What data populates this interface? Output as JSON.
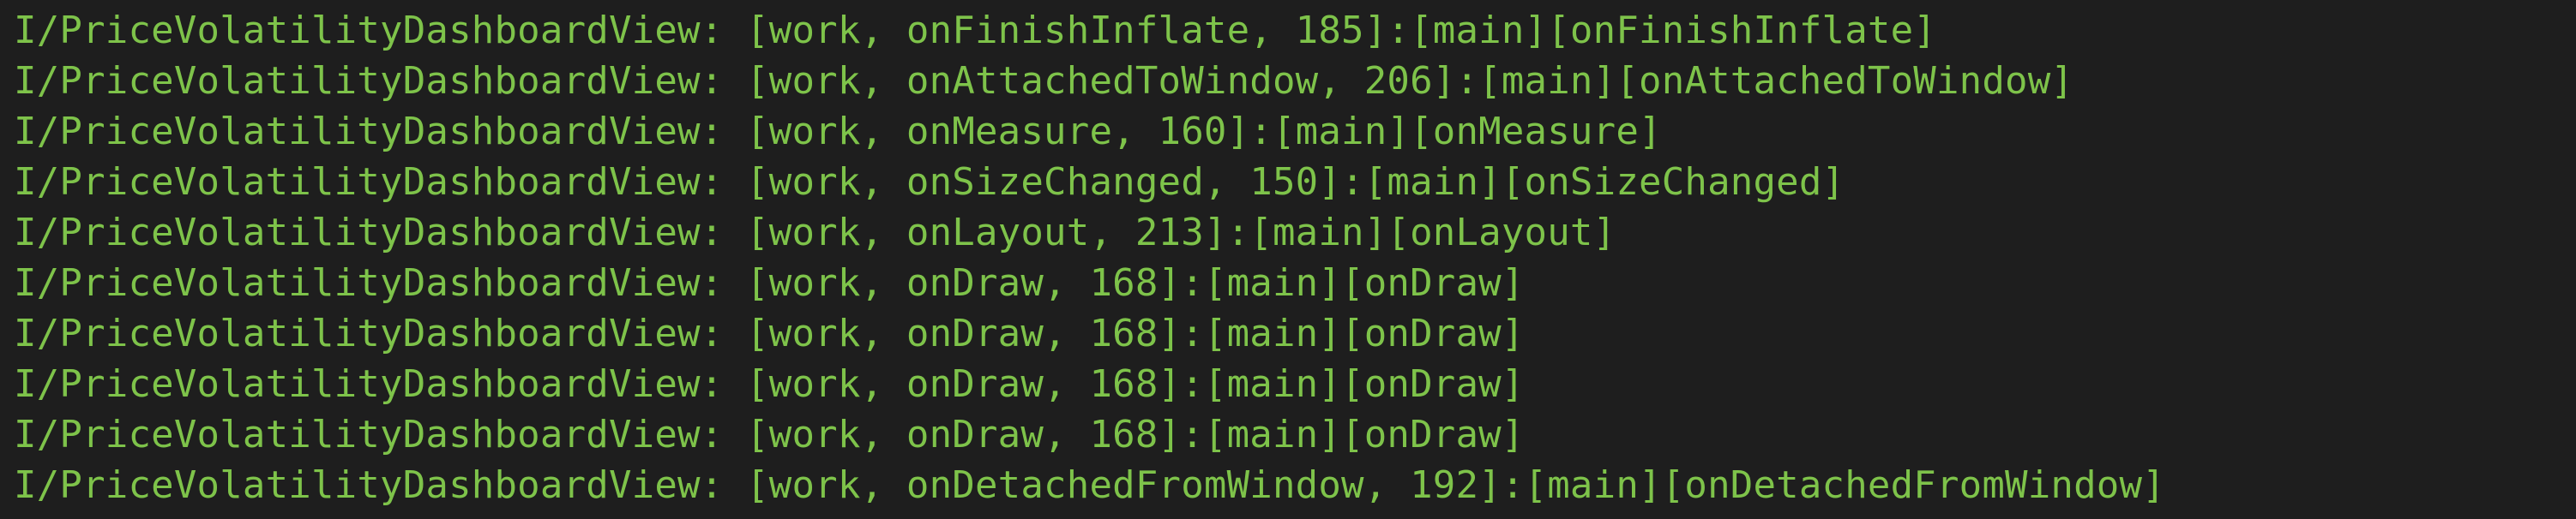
{
  "log": {
    "text_color": "#7ec34a",
    "background_color": "#1e1e1e",
    "lines": [
      "I/PriceVolatilityDashboardView: [work, onFinishInflate, 185]:[main][onFinishInflate]",
      "I/PriceVolatilityDashboardView: [work, onAttachedToWindow, 206]:[main][onAttachedToWindow]",
      "I/PriceVolatilityDashboardView: [work, onMeasure, 160]:[main][onMeasure]",
      "I/PriceVolatilityDashboardView: [work, onSizeChanged, 150]:[main][onSizeChanged]",
      "I/PriceVolatilityDashboardView: [work, onLayout, 213]:[main][onLayout]",
      "I/PriceVolatilityDashboardView: [work, onDraw, 168]:[main][onDraw]",
      "I/PriceVolatilityDashboardView: [work, onDraw, 168]:[main][onDraw]",
      "I/PriceVolatilityDashboardView: [work, onDraw, 168]:[main][onDraw]",
      "I/PriceVolatilityDashboardView: [work, onDraw, 168]:[main][onDraw]",
      "I/PriceVolatilityDashboardView: [work, onDetachedFromWindow, 192]:[main][onDetachedFromWindow]"
    ]
  }
}
